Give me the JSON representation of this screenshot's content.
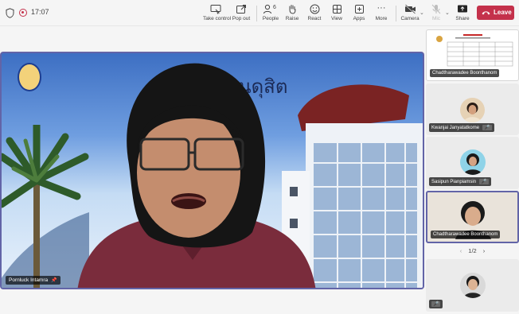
{
  "topbar": {
    "time": "17:07",
    "buttons": {
      "take_control": "Take control",
      "pop_out": "Pop out",
      "people": "People",
      "people_count": "6",
      "raise": "Raise",
      "react": "React",
      "view": "View",
      "apps": "Apps",
      "more": "More",
      "camera": "Camera",
      "mic": "Mic",
      "share": "Share",
      "leave": "Leave"
    }
  },
  "stage": {
    "banner_text": "ัยสวนดุสิต",
    "speaker_name": "Pornluck Intamra"
  },
  "participants": [
    {
      "name": "Chadtharawadee Boonthanom",
      "kind": "shared-content"
    },
    {
      "name": "Kwanjai Janyatatkome",
      "kind": "video",
      "muted": true
    },
    {
      "name": "Sasipun Pianpiamsin",
      "kind": "video",
      "muted": true
    },
    {
      "name": "Chadtharawadee Boonthanom",
      "kind": "video-active"
    },
    {
      "name": "",
      "kind": "video",
      "muted": true
    }
  ],
  "pager": {
    "label": "1/2"
  },
  "colors": {
    "accent": "#6264a7",
    "leave": "#c4314b"
  }
}
